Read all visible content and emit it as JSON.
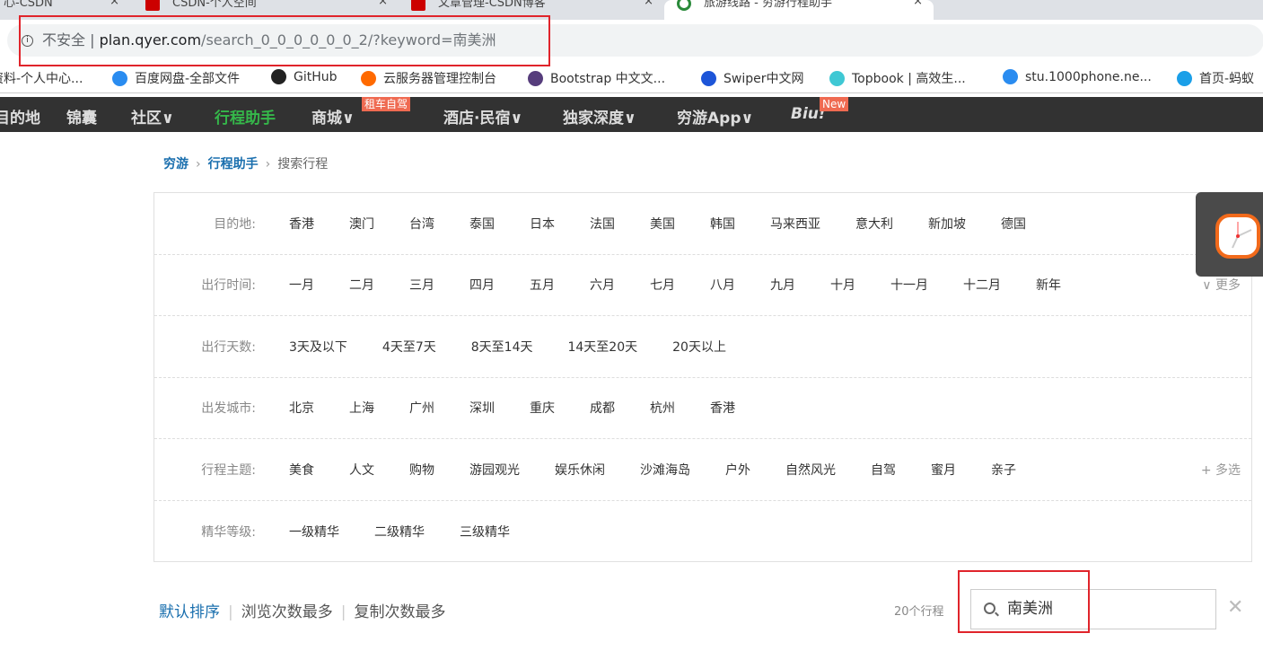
{
  "browser": {
    "tabs": [
      {
        "title": "心-CSDN"
      },
      {
        "title": "CSDN-个人空间"
      },
      {
        "title": "文章管理-CSDN博客"
      },
      {
        "title": "旅游线路 - 穷游行程助手",
        "active": true
      }
    ],
    "address": {
      "security": "不安全",
      "host": "plan.qyer.com",
      "path": "/search_0_0_0_0_0_0_2/?keyword=南美洲"
    },
    "bookmarks": [
      {
        "label": "资料-个人中心...",
        "icon": "csdn-icon"
      },
      {
        "label": "百度网盘-全部文件",
        "icon": "baidu-pan-icon",
        "color": "#2a8cf0"
      },
      {
        "label": "GitHub",
        "icon": "github-icon",
        "color": "#222"
      },
      {
        "label": "云服务器管理控制台",
        "icon": "aliyun-icon",
        "color": "#ff6a00"
      },
      {
        "label": "Bootstrap 中文文...",
        "icon": "bootstrap-icon",
        "color": "#563d7c"
      },
      {
        "label": "Swiper中文网",
        "icon": "swiper-icon",
        "color": "#1d55d8"
      },
      {
        "label": "Topbook | 高效生...",
        "icon": "topbook-icon",
        "color": "#3fc8d4"
      },
      {
        "label": "stu.1000phone.ne...",
        "icon": "qianfeng-icon",
        "color": "#2a8cf0"
      },
      {
        "label": "首页-蚂蚁",
        "icon": "alipay-icon",
        "color": "#1a9fe8"
      }
    ]
  },
  "nav": {
    "items": [
      {
        "label": "目的地"
      },
      {
        "label": "锦囊"
      },
      {
        "label": "社区∨"
      },
      {
        "label": "行程助手",
        "active": true
      },
      {
        "label": "商城∨",
        "badge": "租车自驾"
      },
      {
        "label": "酒店·民宿∨"
      },
      {
        "label": "独家深度∨"
      },
      {
        "label": "穷游App∨"
      },
      {
        "label": "Biu!",
        "badge": "New"
      }
    ]
  },
  "breadcrumb": [
    "穷游",
    "行程助手",
    "搜索行程"
  ],
  "filters": [
    {
      "label": "目的地:",
      "options": [
        "香港",
        "澳门",
        "台湾",
        "泰国",
        "日本",
        "法国",
        "美国",
        "韩国",
        "马来西亚",
        "意大利",
        "新加坡",
        "德国"
      ],
      "more": "∨ 更多"
    },
    {
      "label": "出行时间:",
      "options": [
        "一月",
        "二月",
        "三月",
        "四月",
        "五月",
        "六月",
        "七月",
        "八月",
        "九月",
        "十月",
        "十一月",
        "十二月",
        "新年"
      ],
      "more": "∨ 更多"
    },
    {
      "label": "出行天数:",
      "options": [
        "3天及以下",
        "4天至7天",
        "8天至14天",
        "14天至20天",
        "20天以上"
      ]
    },
    {
      "label": "出发城市:",
      "options": [
        "北京",
        "上海",
        "广州",
        "深圳",
        "重庆",
        "成都",
        "杭州",
        "香港"
      ]
    },
    {
      "label": "行程主题:",
      "options": [
        "美食",
        "人文",
        "购物",
        "游园观光",
        "娱乐休闲",
        "沙滩海岛",
        "户外",
        "自然风光",
        "自驾",
        "蜜月",
        "亲子"
      ],
      "more": "+ 多选"
    },
    {
      "label": "精华等级:",
      "options": [
        "一级精华",
        "二级精华",
        "三级精华"
      ]
    }
  ],
  "sort": {
    "options": [
      "默认排序",
      "浏览次数最多",
      "复制次数最多"
    ],
    "active": 0
  },
  "results": {
    "count": "20个行程"
  },
  "search": {
    "value": "南美洲",
    "clear": "✕"
  },
  "colors": {
    "accent": "#1a6fae",
    "nav_bg": "#323232",
    "nav_active": "#35b84a",
    "badge": "#ef6a51",
    "highlight": "#e0242b"
  }
}
